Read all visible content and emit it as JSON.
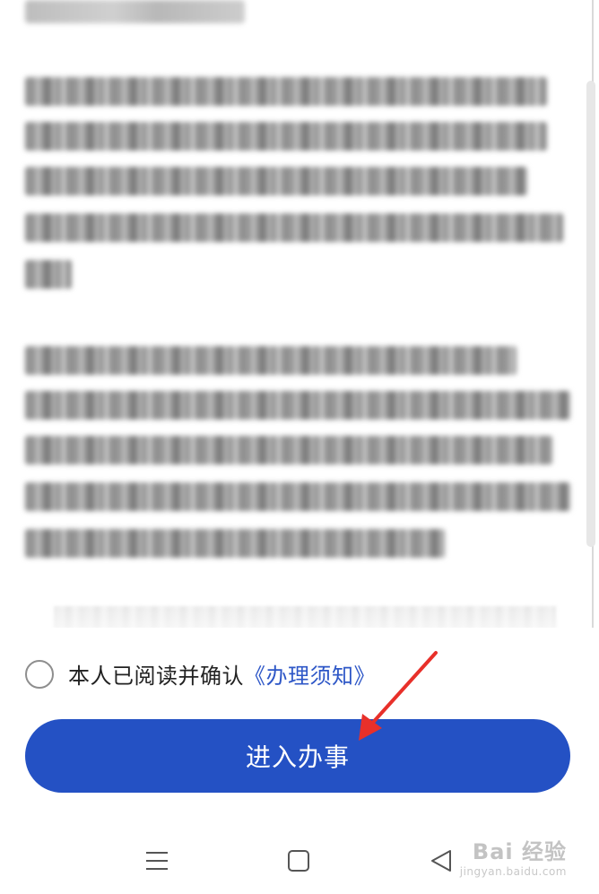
{
  "agreement": {
    "checkbox_checked": false,
    "text": "本人已阅读并确认",
    "link": "《办理须知》"
  },
  "primary_button": {
    "label": "进入办事"
  },
  "nav_bar": {
    "menu_icon": "menu-lines-icon",
    "home_icon": "square-home-icon",
    "back_icon": "triangle-back-icon"
  },
  "watermark": {
    "main": "Bai 经验",
    "sub": "jingyan.baidu.com"
  },
  "colors": {
    "primary": "#2451c4",
    "link": "#2e57c7",
    "annotation": "#e8302a"
  }
}
